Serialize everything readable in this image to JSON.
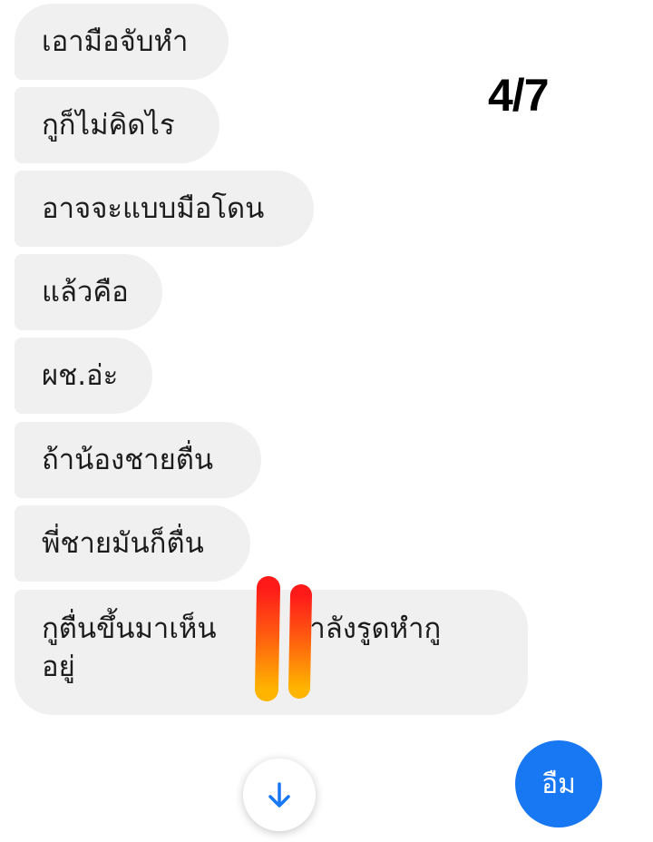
{
  "page_counter": "4/7",
  "messages": [
    "เอามือจับหำ",
    "กูก็ไม่คิดไร",
    "อาจจะแบบมือโดน",
    "แล้วคือ",
    "ผช.อ่ะ",
    "ถ้าน้องชายตื่น",
    "พี่ชายมันก็ตื่น"
  ],
  "last_message": {
    "part1": "กูตื่นขึ้นมาเห็น",
    "part2": "กำลังรูดหำกู",
    "part3": "อยู่"
  },
  "reply_bubble": {
    "text": "อืม",
    "color": "#1877f2"
  },
  "scroll_down_icon": "arrow-down-icon",
  "colors": {
    "incoming_bubble": "#f0f0f0",
    "accent": "#1877f2"
  }
}
